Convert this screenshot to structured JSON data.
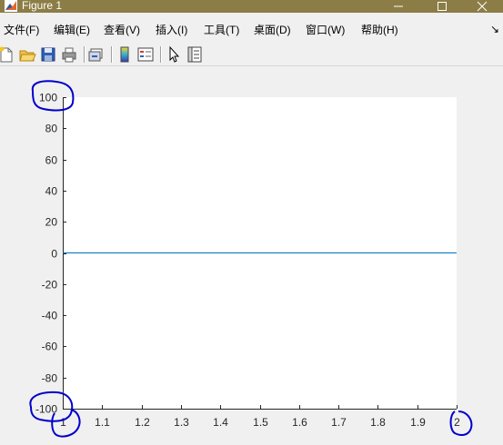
{
  "window": {
    "title": "Figure 1",
    "titlebar_color": "#8b7d45"
  },
  "menubar": {
    "items": [
      {
        "label": "文件(F)"
      },
      {
        "label": "编辑(E)"
      },
      {
        "label": "查看(V)"
      },
      {
        "label": "插入(I)"
      },
      {
        "label": "工具(T)"
      },
      {
        "label": "桌面(D)"
      },
      {
        "label": "窗口(W)"
      },
      {
        "label": "帮助(H)"
      }
    ],
    "overflow_icon": "arrow-icon"
  },
  "toolbar": {
    "buttons": [
      {
        "icon": "new-figure-icon"
      },
      {
        "icon": "open-file-icon"
      },
      {
        "icon": "save-icon"
      },
      {
        "icon": "print-icon"
      },
      {
        "icon": "link-plot-icon"
      },
      {
        "icon": "insert-colorbar-icon"
      },
      {
        "icon": "insert-legend-icon"
      },
      {
        "icon": "edit-plot-icon"
      },
      {
        "icon": "property-inspector-icon"
      }
    ]
  },
  "chart_data": {
    "type": "line",
    "title": "",
    "xlabel": "",
    "ylabel": "",
    "xlim": [
      1,
      2
    ],
    "ylim": [
      -100,
      100
    ],
    "xticks": [
      "1",
      "1.1",
      "1.2",
      "1.3",
      "1.4",
      "1.5",
      "1.6",
      "1.7",
      "1.8",
      "1.9",
      "2"
    ],
    "yticks": [
      "-100",
      "-80",
      "-60",
      "-40",
      "-20",
      "0",
      "20",
      "40",
      "60",
      "80",
      "100"
    ],
    "grid": false,
    "series": [
      {
        "color": "#0072bd",
        "x": [
          1,
          2
        ],
        "y": [
          0,
          0
        ]
      }
    ],
    "annotation_color": "#0000cc"
  }
}
